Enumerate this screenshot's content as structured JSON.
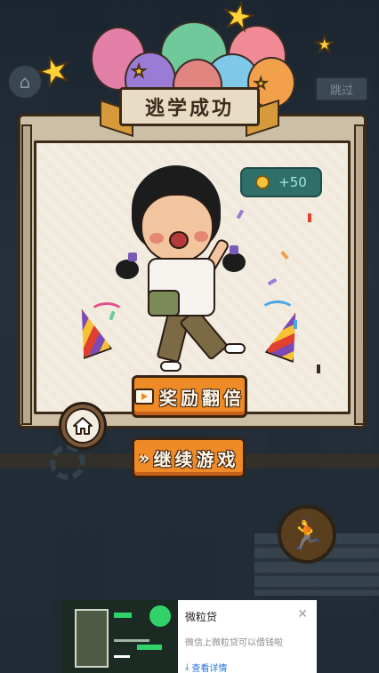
{
  "background": {
    "skip_label": "跳过"
  },
  "dialog": {
    "title": "逃学成功",
    "reward": {
      "icon": "coin-icon",
      "amount": "+50"
    },
    "buttons": {
      "double_reward": "奖励翻倍",
      "continue": "继续游戏"
    },
    "home_icon": "home-icon"
  },
  "ad": {
    "title": "微粒贷",
    "description": "微信上微粒贷可以借钱啦",
    "link_label": "查看详情",
    "close_icon": "close-icon"
  },
  "colors": {
    "button_orange": "#ef8b26",
    "reward_badge": "#2f6f6a",
    "panel_paper": "#f3ede1",
    "ad_link": "#2a72d9"
  }
}
